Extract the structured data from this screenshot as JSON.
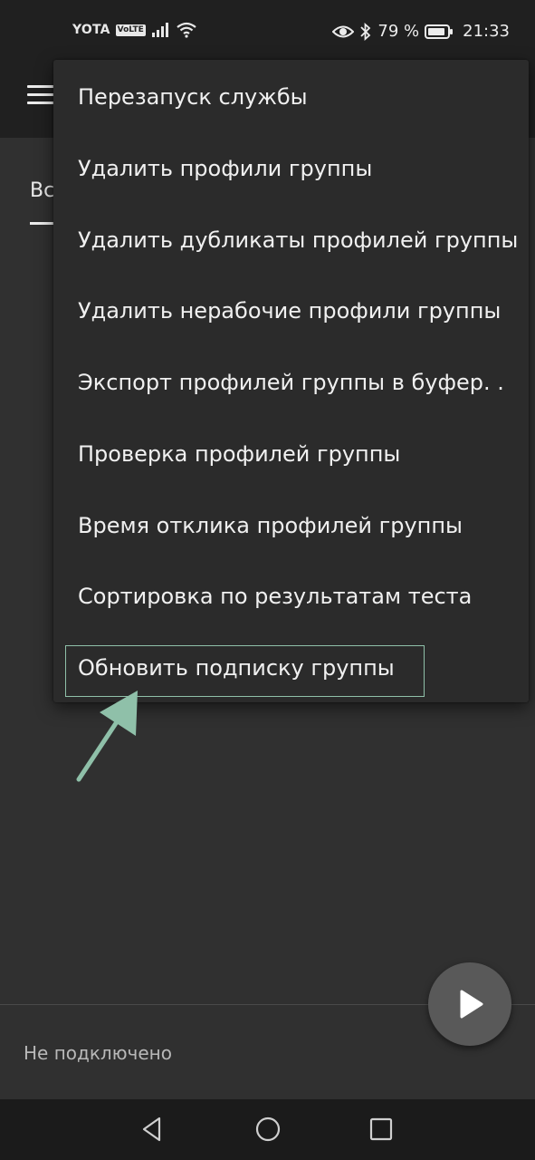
{
  "status_bar": {
    "carrier": "YOTA",
    "volte_badge": "VoLTE",
    "battery_percent": "79 %",
    "time": "21:33",
    "icons": [
      "signal-icon",
      "wifi-icon",
      "eye-icon",
      "bluetooth-icon",
      "battery-icon"
    ]
  },
  "app_bar": {
    "menu_icon": "hamburger-icon"
  },
  "tabs": {
    "visible_label": "Вс"
  },
  "menu": {
    "items": [
      "Перезапуск службы",
      "Удалить профили группы",
      "Удалить дубликаты профилей группы",
      "Удалить нерабочие профили группы",
      "Экспорт профилей группы в буфер. .",
      "Проверка профилей группы",
      "Время отклика профилей группы",
      "Сортировка по результатам теста",
      "Обновить подписку группы"
    ],
    "highlighted_index": 8,
    "highlight_color": "#8fc0a9"
  },
  "footer": {
    "connection_status": "Не подключено",
    "fab_icon": "play-icon"
  },
  "nav_bar": {
    "buttons": [
      "back-icon",
      "home-icon",
      "recents-icon"
    ]
  }
}
